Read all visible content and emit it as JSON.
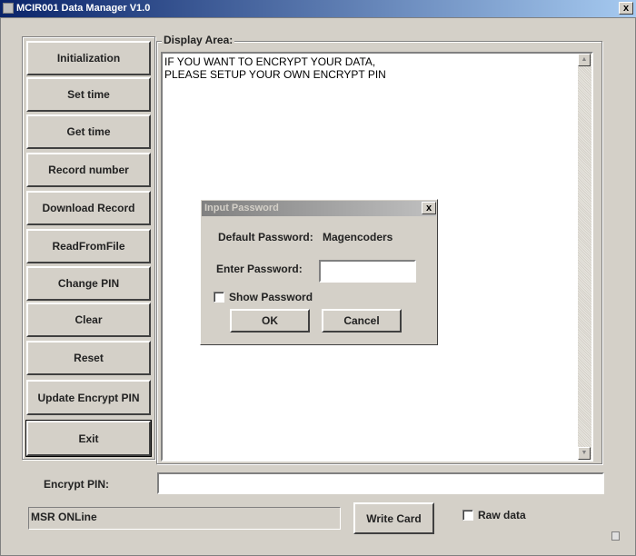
{
  "window": {
    "title": "MCIR001 Data Manager V1.0",
    "close": "x"
  },
  "sidebar": {
    "buttons": [
      "Initialization",
      "Set time",
      "Get time",
      "Record number",
      "Download Record",
      "ReadFromFile",
      "Change PIN",
      "Clear",
      "Reset",
      "Update Encrypt PIN",
      "Exit"
    ]
  },
  "display": {
    "label": "Display Area:",
    "lines": [
      "IF YOU WANT TO ENCRYPT YOUR DATA,",
      "PLEASE SETUP YOUR OWN ENCRYPT PIN"
    ]
  },
  "dialog": {
    "title": "Input Password",
    "close": "x",
    "default_label": "Default Password:",
    "default_value": "Magencoders",
    "enter_label": "Enter Password:",
    "password_value": "",
    "show_password": "Show Password",
    "show_password_checked": false,
    "ok": "OK",
    "cancel": "Cancel"
  },
  "bottom": {
    "encrypt_label": "Encrypt PIN:",
    "encrypt_value": "",
    "status": "MSR ONLine",
    "write_card": "Write Card",
    "raw_data": "Raw data",
    "raw_data_checked": false
  }
}
